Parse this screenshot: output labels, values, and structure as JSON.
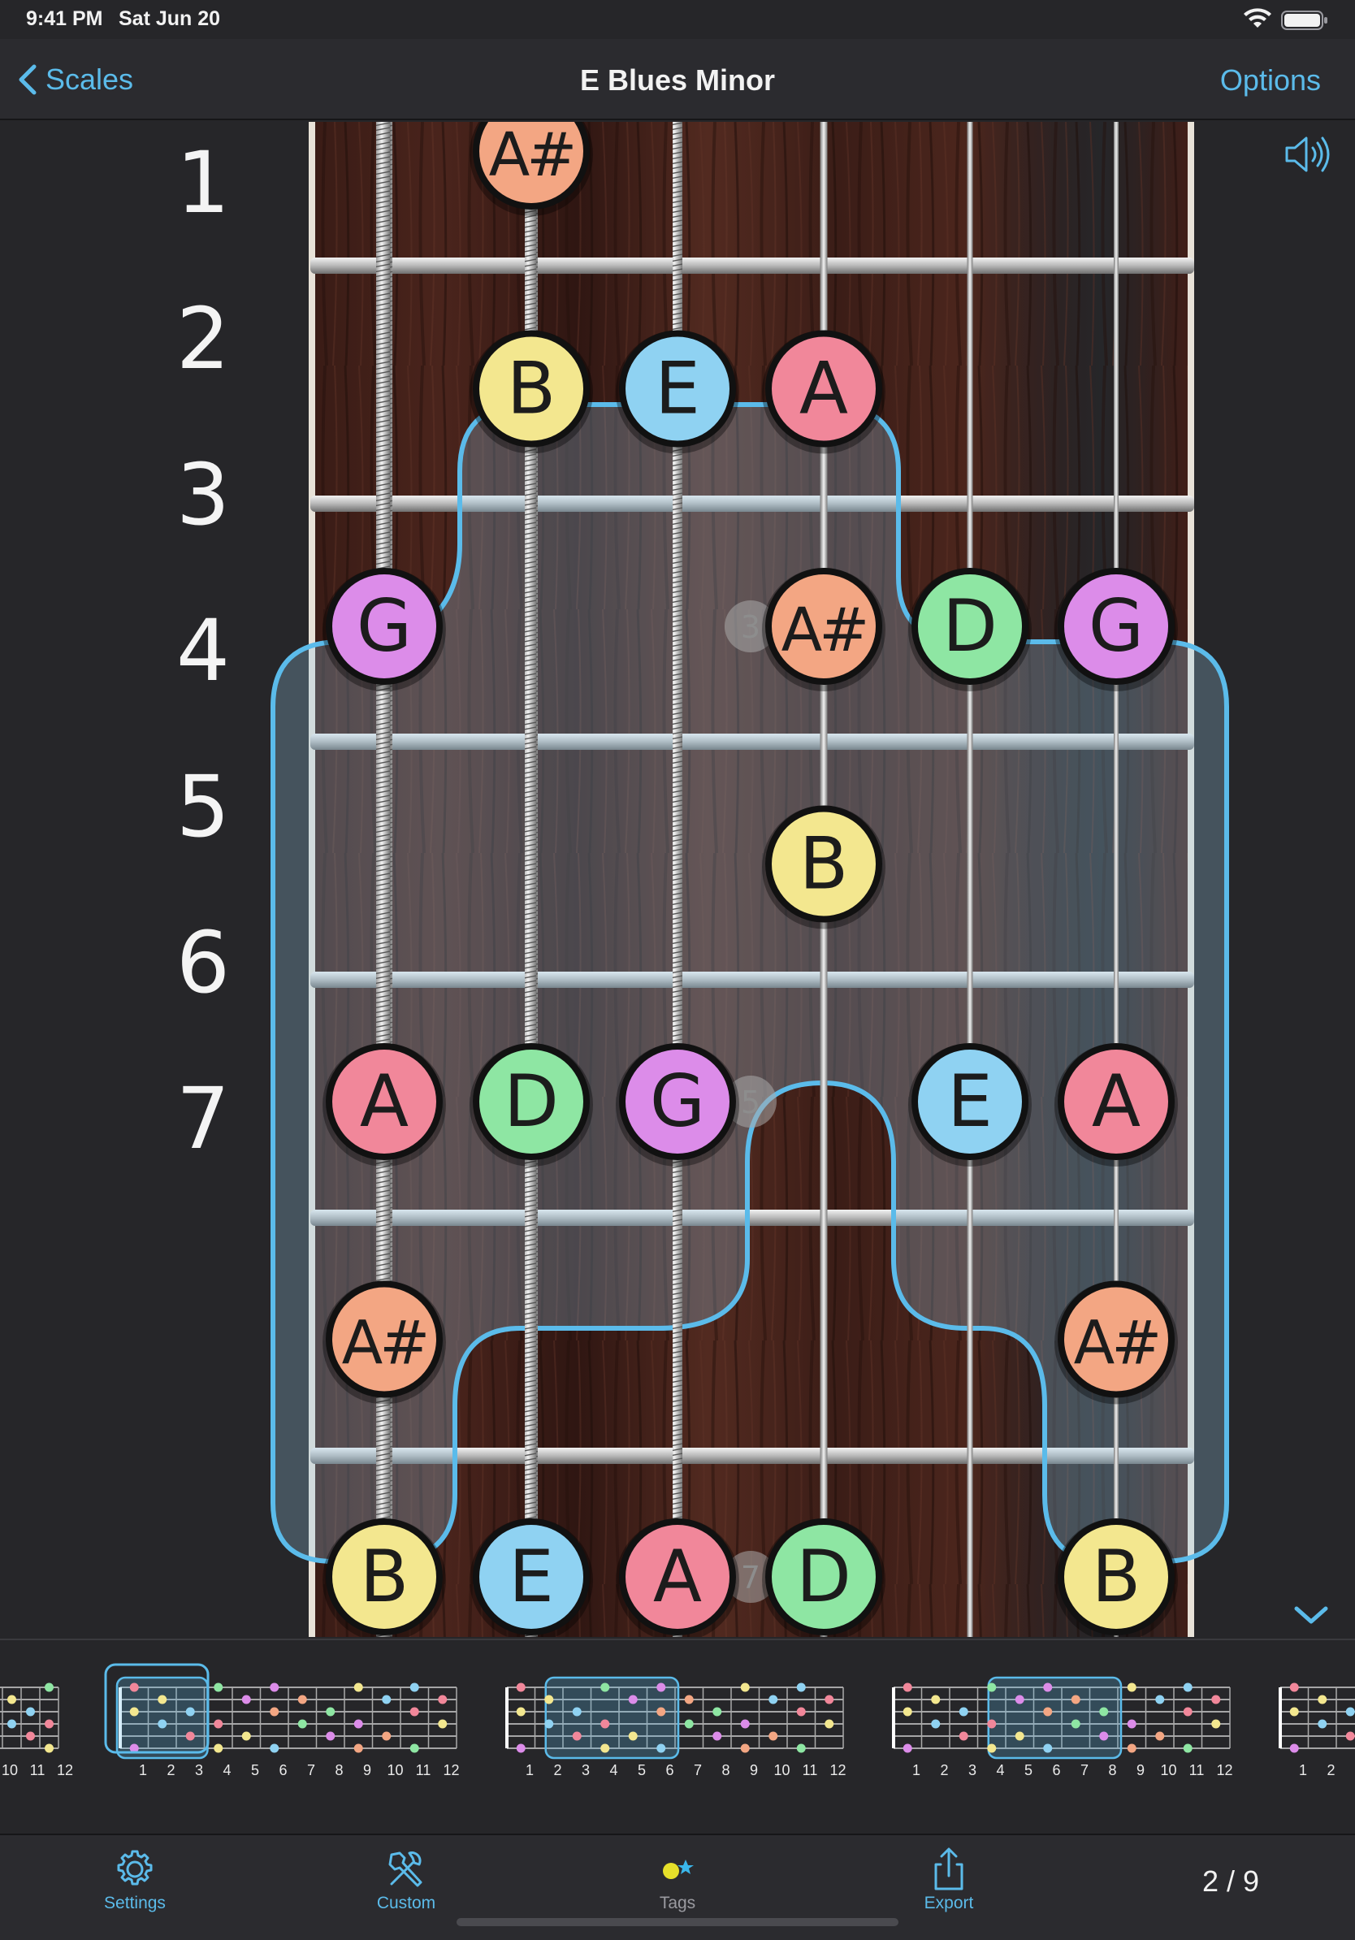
{
  "status_bar": {
    "time": "9:41 PM",
    "date": "Sat Jun 20"
  },
  "nav": {
    "back_label": "Scales",
    "title": "E Blues Minor",
    "options_label": "Options"
  },
  "fretboard": {
    "fret_numbers": [
      "1",
      "2",
      "3",
      "4",
      "5",
      "6",
      "7"
    ],
    "notes": [
      {
        "fret": 1,
        "string": 2,
        "note": "A#"
      },
      {
        "fret": 2,
        "string": 2,
        "note": "B"
      },
      {
        "fret": 2,
        "string": 3,
        "note": "E"
      },
      {
        "fret": 2,
        "string": 4,
        "note": "A"
      },
      {
        "fret": 3,
        "string": 1,
        "note": "G"
      },
      {
        "fret": 3,
        "string": 4,
        "note": "A#"
      },
      {
        "fret": 3,
        "string": 5,
        "note": "D"
      },
      {
        "fret": 3,
        "string": 6,
        "note": "G"
      },
      {
        "fret": 4,
        "string": 4,
        "note": "B"
      },
      {
        "fret": 5,
        "string": 1,
        "note": "A"
      },
      {
        "fret": 5,
        "string": 2,
        "note": "D"
      },
      {
        "fret": 5,
        "string": 3,
        "note": "G"
      },
      {
        "fret": 5,
        "string": 5,
        "note": "E"
      },
      {
        "fret": 5,
        "string": 6,
        "note": "A"
      },
      {
        "fret": 6,
        "string": 1,
        "note": "A#"
      },
      {
        "fret": 6,
        "string": 6,
        "note": "A#"
      },
      {
        "fret": 7,
        "string": 1,
        "note": "B"
      },
      {
        "fret": 7,
        "string": 2,
        "note": "E"
      },
      {
        "fret": 7,
        "string": 3,
        "note": "A"
      },
      {
        "fret": 7,
        "string": 4,
        "note": "D"
      },
      {
        "fret": 7,
        "string": 6,
        "note": "B"
      }
    ],
    "inlay_markers": [
      {
        "fret": 3,
        "label": "3"
      },
      {
        "fret": 5,
        "label": "5"
      },
      {
        "fret": 7,
        "label": "7"
      }
    ],
    "note_colors": {
      "A": "#f1879a",
      "A#": "#f3a683",
      "B": "#f3e78f",
      "D": "#8ee6a3",
      "E": "#8fd2f2",
      "G": "#dc8ce9"
    },
    "accent_color": "#5bbbea"
  },
  "thumbnails": {
    "partial_left_numbers": [
      "10",
      "11",
      "12"
    ],
    "full_numbers": [
      "1",
      "2",
      "3",
      "4",
      "5",
      "6",
      "7",
      "8",
      "9",
      "10",
      "11",
      "12"
    ],
    "partial_right_numbers": [
      "1",
      "2"
    ]
  },
  "tab_bar": {
    "settings_label": "Settings",
    "custom_label": "Custom",
    "tags_label": "Tags",
    "export_label": "Export",
    "page_indicator": "2 / 9"
  }
}
